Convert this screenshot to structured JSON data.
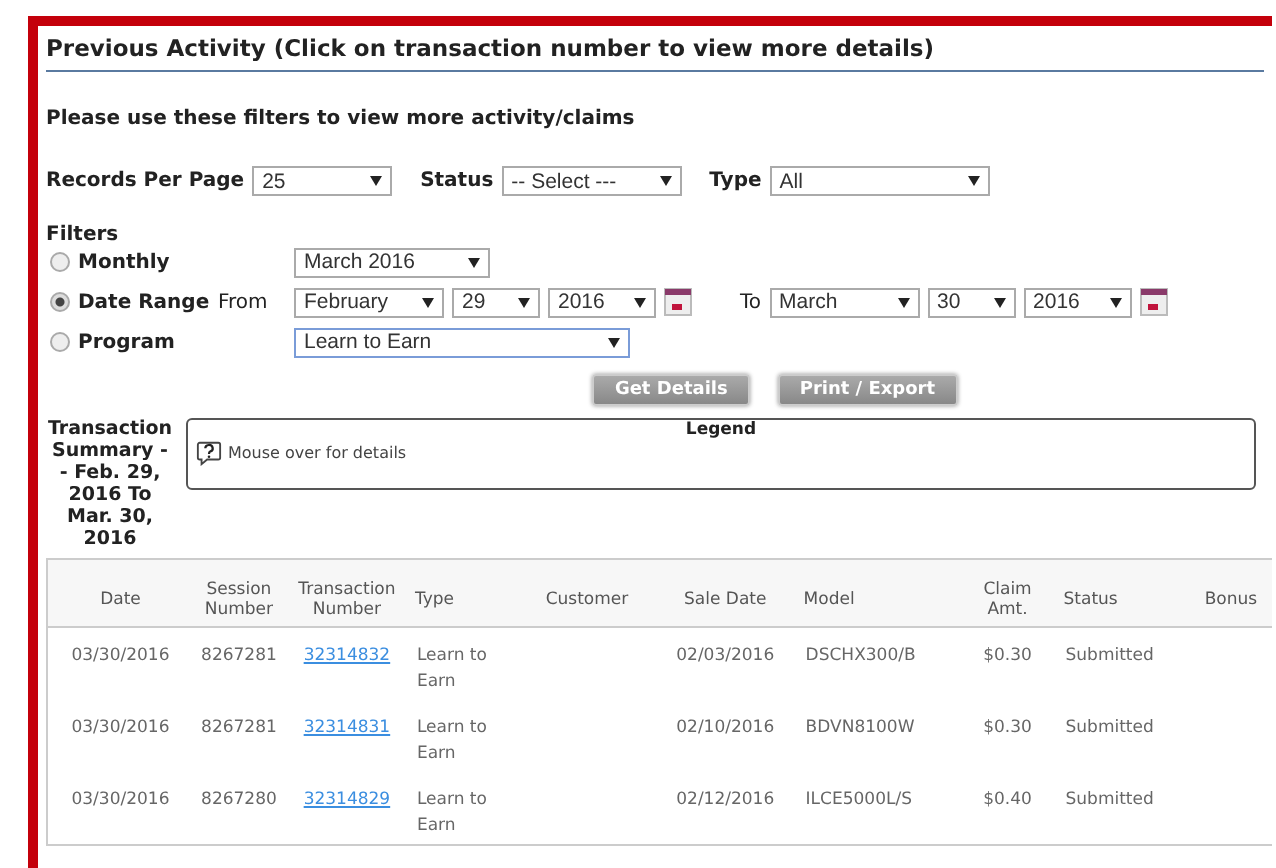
{
  "panel": {
    "title": "Previous Activity (Click on transaction number to view more details)",
    "intro": "Please use these filters to view more activity/claims"
  },
  "top_filters": [
    {
      "label": "Records Per Page",
      "value": "25"
    },
    {
      "label": "Status",
      "value": "-- Select ---"
    },
    {
      "label": "Type",
      "value": "All"
    }
  ],
  "filters": {
    "label": "Filters",
    "options": [
      {
        "label": "Monthly",
        "selected": false,
        "kind": "month"
      },
      {
        "label": "Date Range",
        "selected": true,
        "kind": "range"
      },
      {
        "label": "Program",
        "selected": false,
        "kind": "program"
      }
    ],
    "month_value": "March 2016",
    "from_label": "From",
    "from": [
      "February",
      "29",
      "2016"
    ],
    "to_label": "To",
    "to": [
      "March",
      "30",
      "2016"
    ],
    "program_value": "Learn to Earn"
  },
  "buttons": [
    "Get Details",
    "Print / Export"
  ],
  "summary": "Transaction Summary - - Feb. 29, 2016 To Mar. 30, 2016",
  "legend": {
    "title": "Legend",
    "hint": "Mouse over for details"
  },
  "table": {
    "columns": [
      "Date",
      "Session Number",
      "Transaction Number",
      "Type",
      "Customer",
      "Sale Date",
      "Model",
      "Claim Amt.",
      "Status",
      "Bonus"
    ],
    "rows": [
      {
        "date": "03/30/2016",
        "session": "8267281",
        "transaction": "32314832",
        "type": "Learn to Earn",
        "sale_date": "02/03/2016",
        "model": "DSCHX300/B",
        "claim": "$0.30",
        "status": "Submitted"
      },
      {
        "date": "03/30/2016",
        "session": "8267281",
        "transaction": "32314831",
        "type": "Learn to Earn",
        "sale_date": "02/10/2016",
        "model": "BDVN8100W",
        "claim": "$0.30",
        "status": "Submitted"
      },
      {
        "date": "03/30/2016",
        "session": "8267280",
        "transaction": "32314829",
        "type": "Learn to Earn",
        "sale_date": "02/12/2016",
        "model": "ILCE5000L/S",
        "claim": "$0.40",
        "status": "Submitted"
      }
    ]
  }
}
